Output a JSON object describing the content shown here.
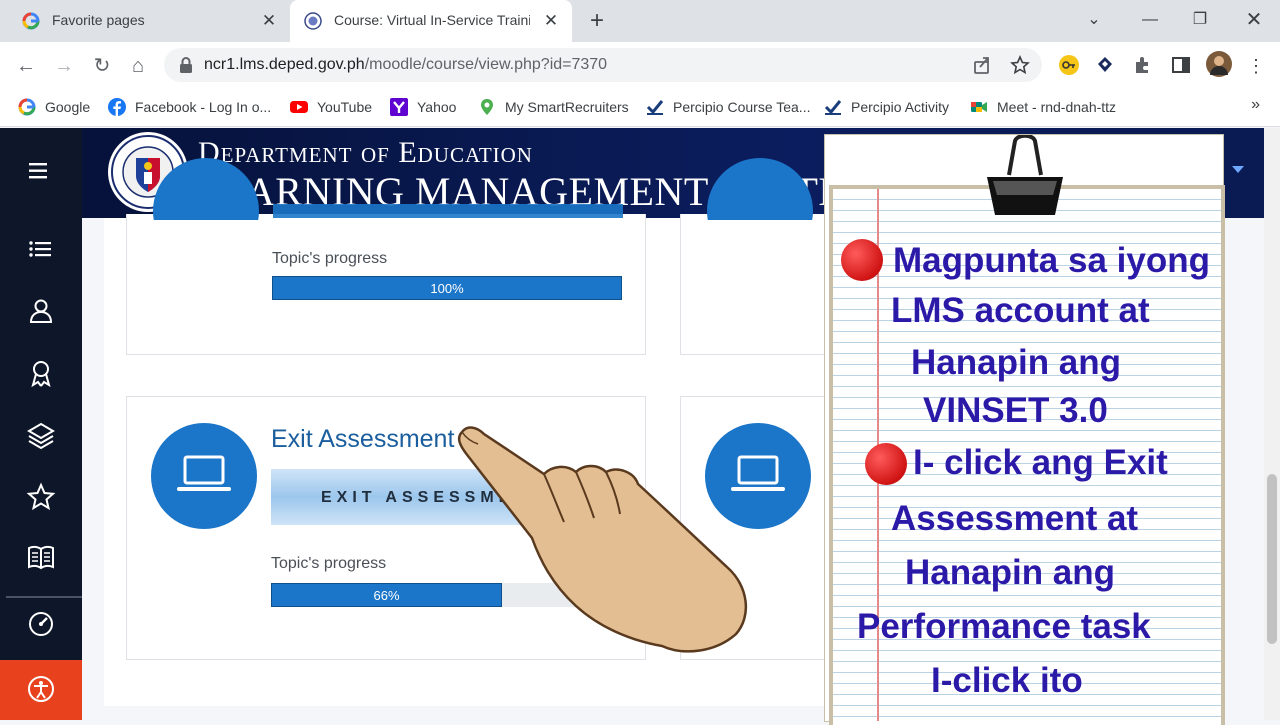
{
  "browser": {
    "tabs": [
      {
        "title": "Favorite pages",
        "active": false
      },
      {
        "title": "Course: Virtual In-Service Training",
        "active": true
      }
    ],
    "url_host": "ncr1.lms.deped.gov.ph",
    "url_path": "/moodle/course/view.php?id=7370",
    "bookmarks": [
      {
        "label": "Google",
        "icon": "google-icon"
      },
      {
        "label": "Facebook - Log In o...",
        "icon": "facebook-icon"
      },
      {
        "label": "YouTube",
        "icon": "youtube-icon"
      },
      {
        "label": "Yahoo",
        "icon": "yahoo-icon"
      },
      {
        "label": "My SmartRecruiters",
        "icon": "smartrecruiters-icon"
      },
      {
        "label": "Percipio Course Tea...",
        "icon": "percipio-icon"
      },
      {
        "label": "Percipio Activity",
        "icon": "percipio-icon"
      },
      {
        "label": "Meet - rnd-dnah-ttz",
        "icon": "meet-icon"
      }
    ],
    "more_bookmarks": "»"
  },
  "header": {
    "dept": "Department of Education",
    "system": "LEARNING MANAGEMENT SYSTEM"
  },
  "cards": {
    "top": {
      "progress_label": "Topic's progress",
      "progress": 100,
      "progress_text": "100%"
    },
    "exit": {
      "title": "Exit Assessment",
      "banner": "EXIT ASSESSMENT",
      "progress_label": "Topic's progress",
      "progress": 66,
      "progress_text": "66%"
    }
  },
  "note": {
    "lines": [
      "Magpunta sa iyong",
      "LMS account at",
      "Hanapin ang",
      "VINSET 3.0",
      "I- click ang Exit",
      "Assessment at",
      "Hanapin ang",
      "Performance task",
      "I-click ito"
    ]
  },
  "colors": {
    "accent": "#1b75c8",
    "note_text": "#2b19a8",
    "sidebar": "#0e1629",
    "sidebar_accent": "#e8411e"
  }
}
